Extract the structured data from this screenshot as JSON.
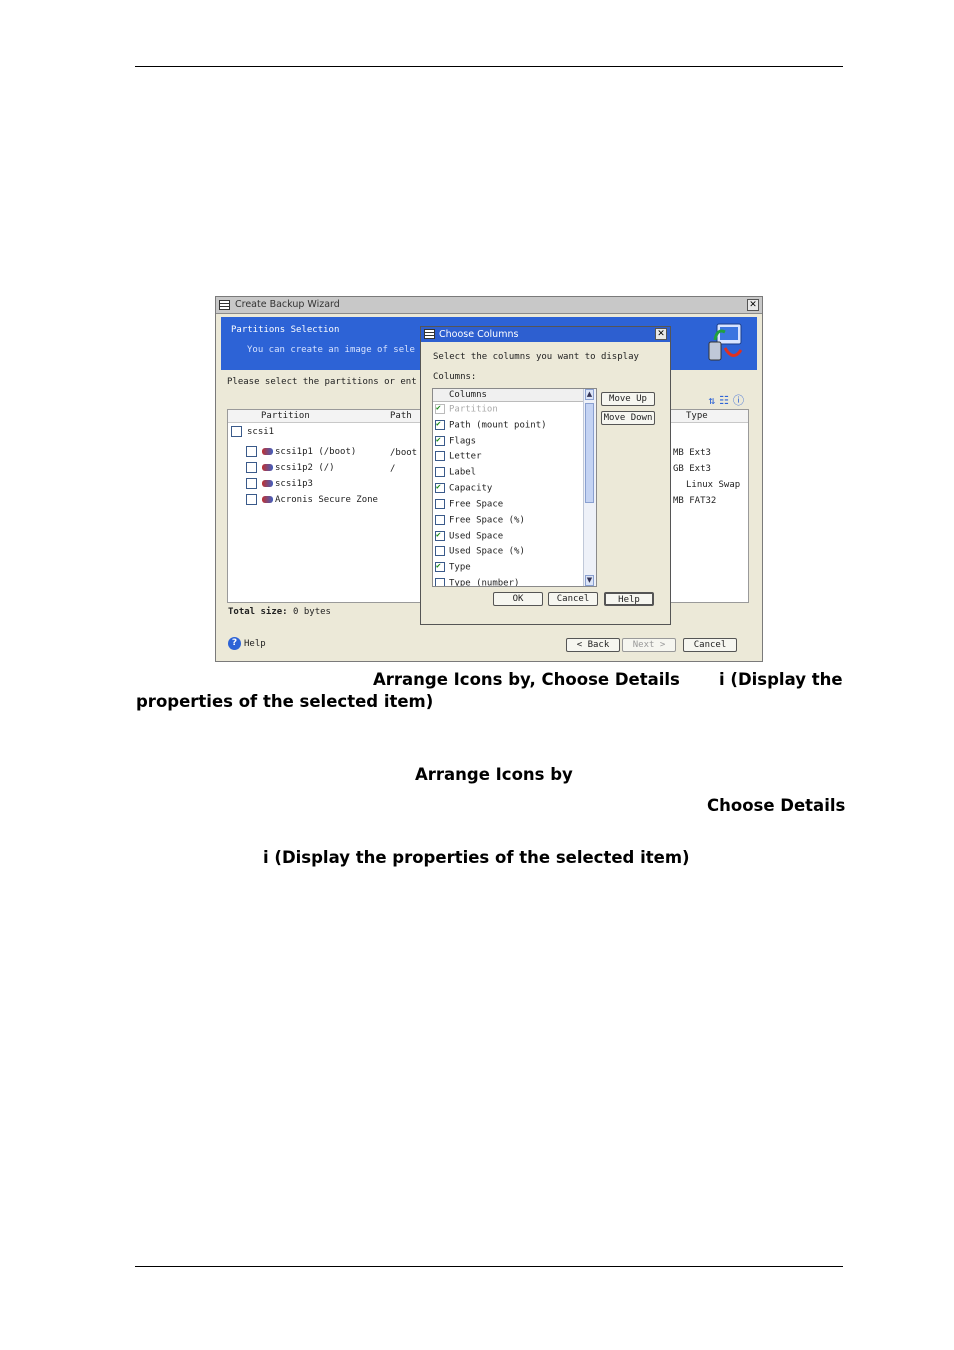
{
  "wizard": {
    "title": "Create Backup Wizard",
    "banner_heading": "Partitions Selection",
    "banner_sub": "You can create an image of sele",
    "prompt": "Please select the partitions or ent",
    "columns": {
      "partition": "Partition",
      "path": "Path",
      "type": "Type"
    },
    "disk_label": "scsi1",
    "rows": [
      {
        "name": "scsi1p1 (/boot)",
        "path": "/boot",
        "type": "MB Ext3"
      },
      {
        "name": "scsi1p2 (/)",
        "path": "/",
        "type": "GB Ext3"
      },
      {
        "name": "scsi1p3",
        "path": "",
        "type": "Linux Swap"
      },
      {
        "name": "Acronis Secure Zone",
        "path": "",
        "type": "MB FAT32"
      }
    ],
    "total_size_label": "Total size:",
    "total_size_value": "0 bytes",
    "help_label": "Help",
    "back_label": "< Back",
    "next_label": "Next >",
    "cancel_label": "Cancel"
  },
  "dialog": {
    "title": "Choose Columns",
    "instruction": "Select the columns you want to display",
    "columns_label": "Columns:",
    "list_header": "Columns",
    "items": [
      {
        "label": "Partition",
        "checked": true,
        "disabled": true
      },
      {
        "label": "Path (mount point)",
        "checked": true,
        "disabled": false
      },
      {
        "label": "Flags",
        "checked": true,
        "disabled": false
      },
      {
        "label": "Letter",
        "checked": false,
        "disabled": false
      },
      {
        "label": "Label",
        "checked": false,
        "disabled": false
      },
      {
        "label": "Capacity",
        "checked": true,
        "disabled": false
      },
      {
        "label": "Free Space",
        "checked": false,
        "disabled": false
      },
      {
        "label": "Free Space (%)",
        "checked": false,
        "disabled": false
      },
      {
        "label": "Used Space",
        "checked": true,
        "disabled": false
      },
      {
        "label": "Used Space (%)",
        "checked": false,
        "disabled": false
      },
      {
        "label": "Type",
        "checked": true,
        "disabled": false
      },
      {
        "label": "Type (number)",
        "checked": false,
        "disabled": false
      }
    ],
    "move_up": "Move Up",
    "move_down": "Move Down",
    "ok": "OK",
    "cancel": "Cancel",
    "help": "Help"
  },
  "captions": {
    "line1a": "Arrange Icons by, Choose Details",
    "line1b": "i (Display the",
    "line2": "properties of the selected item)",
    "line3": "Arrange Icons by",
    "line4": "Choose Details",
    "line5": "i (Display the properties of the selected item)"
  }
}
